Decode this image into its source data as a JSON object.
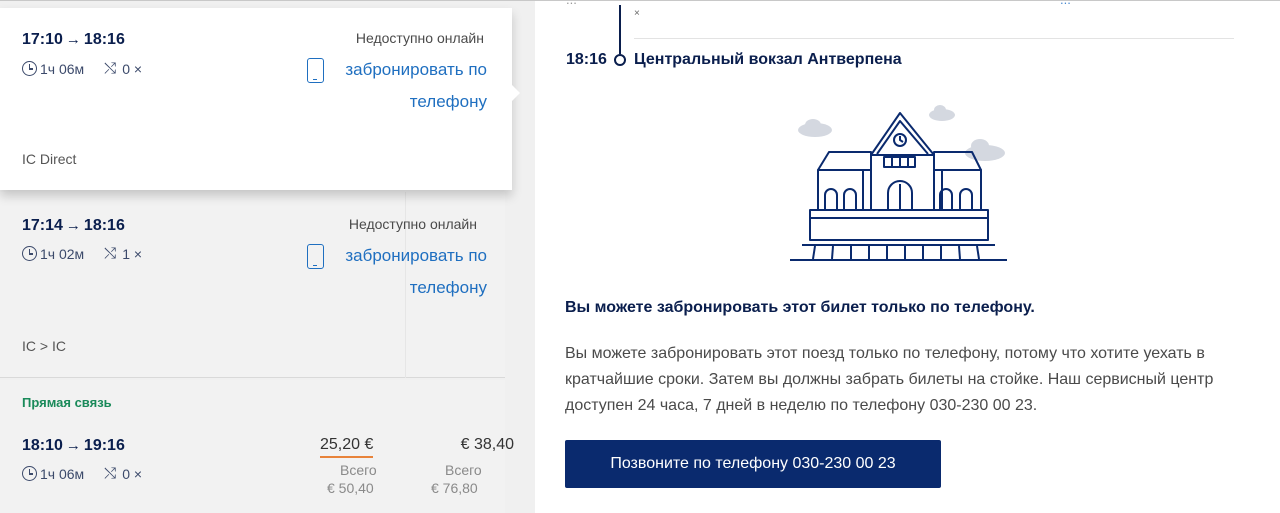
{
  "journeys": [
    {
      "depart": "17:10",
      "arrive": "18:16",
      "duration": "1ч 06м",
      "transfers": "0 ×",
      "status": "Недоступно онлайн",
      "phone_link_line1": "забронировать по",
      "phone_link_line2": "телефону",
      "train_type": "IC Direct"
    },
    {
      "depart": "17:14",
      "arrive": "18:16",
      "duration": "1ч 02м",
      "transfers": "1 ×",
      "status": "Недоступно онлайн",
      "phone_link_line1": "забронировать по",
      "phone_link_line2": "телефону",
      "train_type": "IC  >  IC"
    },
    {
      "label": "Прямая связь",
      "depart": "18:10",
      "arrive": "19:16",
      "duration": "1ч 06м",
      "transfers": "0 ×",
      "price_main": "25,20 €",
      "price_alt": "€ 38,40",
      "total_label": "Всего",
      "total_main": "€ 50,40",
      "total_alt": "€ 76,80"
    }
  ],
  "detail": {
    "top_fragment_left": "...",
    "top_fragment_right": "...",
    "cross": "×",
    "arrive_time": "18:16",
    "station": "Центральный вокзал Антверпена",
    "info_title": "Вы можете забронировать этот билет только по телефону.",
    "info_text": "Вы можете забронировать этот поезд только по телефону, потому что хотите уехать в кратчайшие сроки. Затем вы должны забрать билеты на стойке. Наш сервисный центр доступен 24 часа, 7 дней в неделю по телефону 030-230 00 23.",
    "call_button": "Позвоните по телефону 030-230 00 23"
  },
  "colors": {
    "navy": "#0a1e4d",
    "link_blue": "#1f6fc0",
    "button_bg": "#0a2a6e",
    "green_label": "#1a8a5a",
    "price_underline": "#e8833a"
  }
}
